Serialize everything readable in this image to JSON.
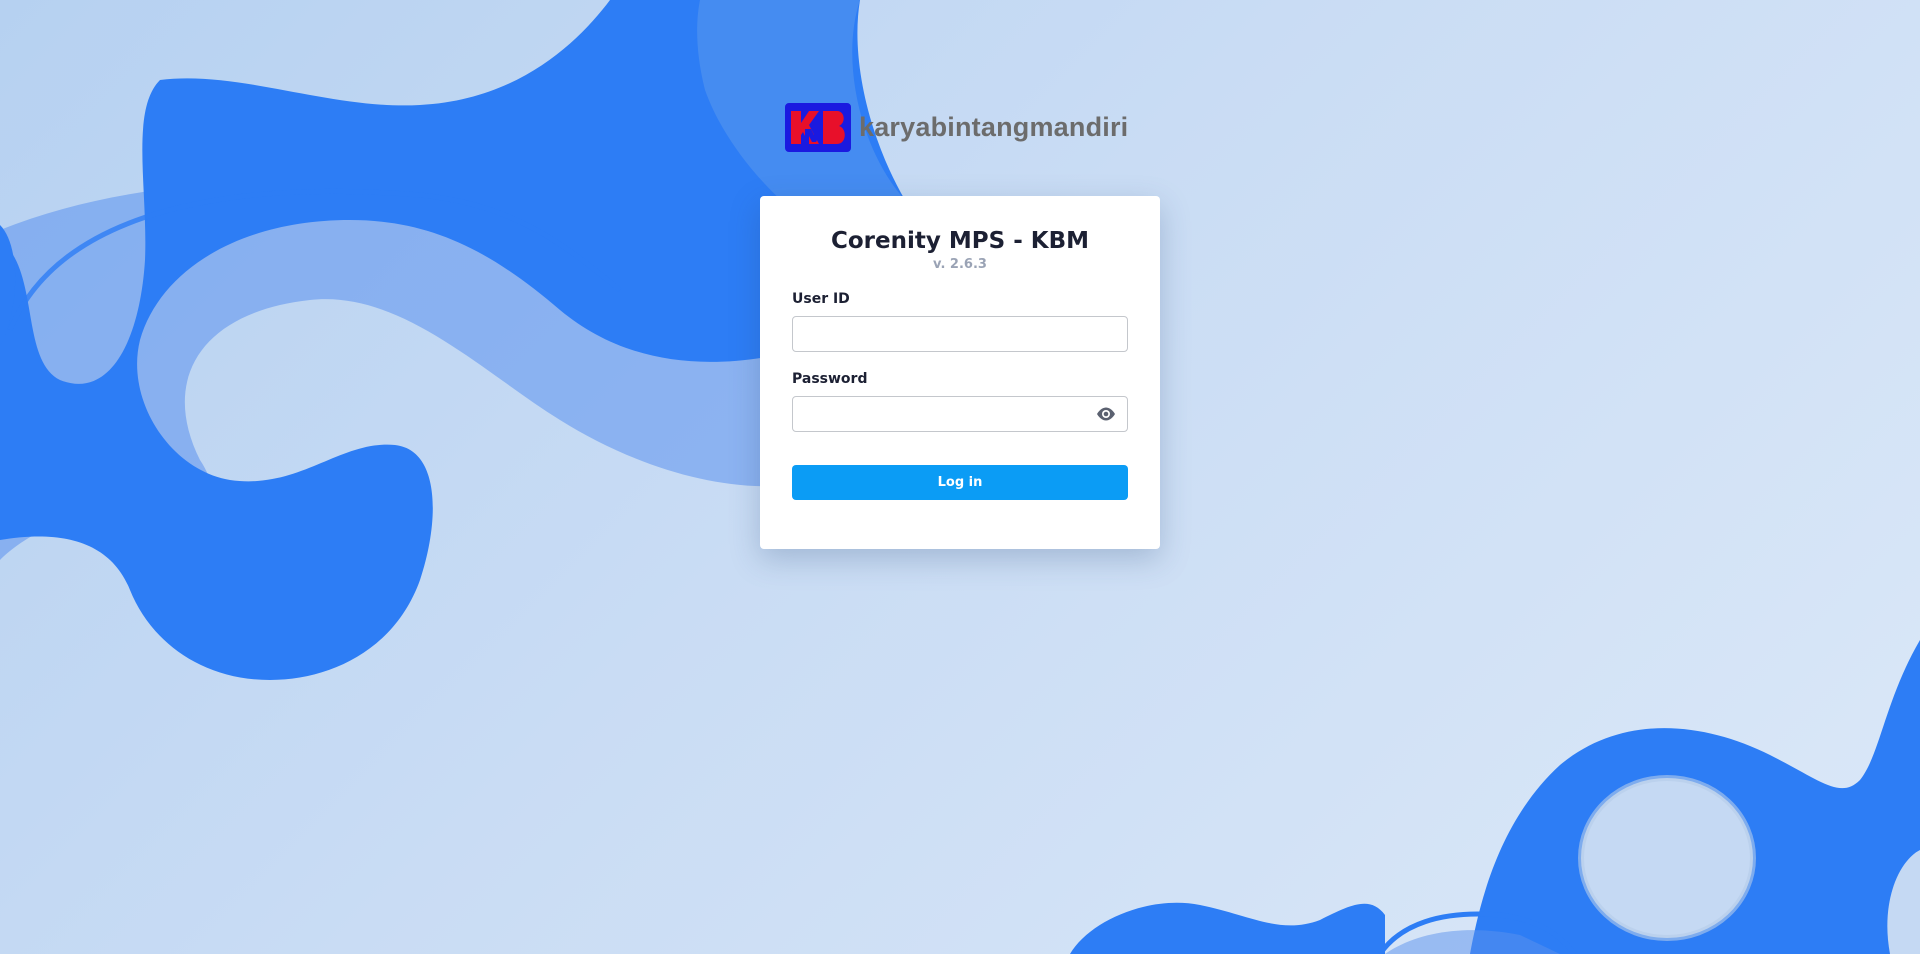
{
  "brand": {
    "name": "karyabintangmandiri"
  },
  "login": {
    "title": "Corenity MPS - KBM",
    "version": "v. 2.6.3",
    "user_id_label": "User ID",
    "user_id_value": "",
    "password_label": "Password",
    "password_value": "",
    "submit_label": "Log in"
  },
  "icons": {
    "password_toggle": "eye-icon",
    "logo": "kbm-logo"
  },
  "colors": {
    "primary_button": "#0b9cf5",
    "background_wave": "#2d7df5",
    "background_light": "#c9dcf4",
    "logo_red": "#e8102a",
    "logo_blue": "#1a1ae0"
  }
}
